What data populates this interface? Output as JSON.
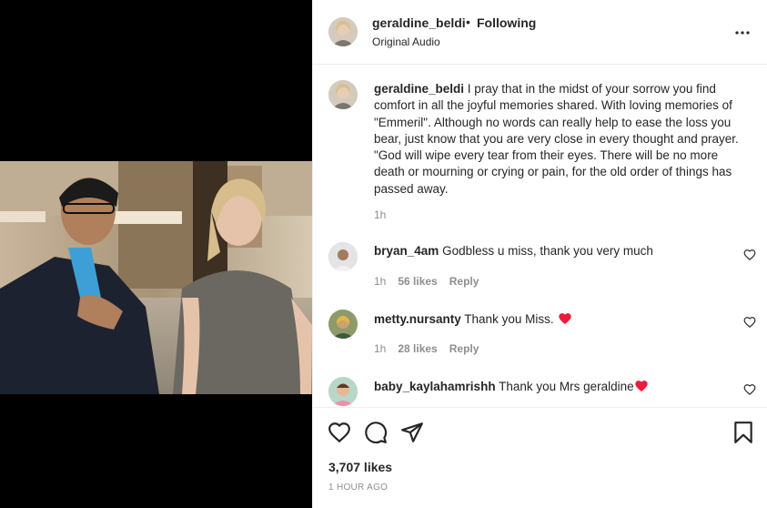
{
  "post": {
    "username": "geraldine_beldi",
    "separator": "•",
    "follow_status": "Following",
    "audio": "Original Audio"
  },
  "caption": {
    "username": "geraldine_beldi",
    "text": "I pray that in the midst of your sorrow you find comfort in all the joyful memories shared. With loving memories of \"Emmeril\". Although no words can really help to ease the loss you bear, just know that you are very close in every thought and prayer. \"God will wipe every tear from their eyes. There will be no more death or mourning or crying or pain, for the old order of things has passed away.",
    "time": "1h"
  },
  "comments": [
    {
      "username": "bryan_4am",
      "text": "Godbless u miss, thank you very much",
      "time": "1h",
      "likes": "56 likes",
      "reply": "Reply",
      "emoji": ""
    },
    {
      "username": "metty.nursanty",
      "text": "Thank you Miss.",
      "time": "1h",
      "likes": "28 likes",
      "reply": "Reply",
      "emoji": "red-heart"
    },
    {
      "username": "baby_kaylahamrishh",
      "text": "Thank you Mrs geraldine",
      "time": "",
      "likes": "",
      "reply": "",
      "emoji": "red-heart"
    }
  ],
  "stats": {
    "likes": "3,707 likes",
    "time_ago": "1 HOUR AGO"
  },
  "icons": {
    "more": "more-horizontal-icon",
    "like": "heart-outline-icon",
    "comment": "comment-bubble-icon",
    "share": "paper-plane-icon",
    "save": "bookmark-icon"
  },
  "colors": {
    "text": "#262626",
    "secondary": "#8e8e8e",
    "heart": "#ed1c3c",
    "divider": "#efefef"
  }
}
